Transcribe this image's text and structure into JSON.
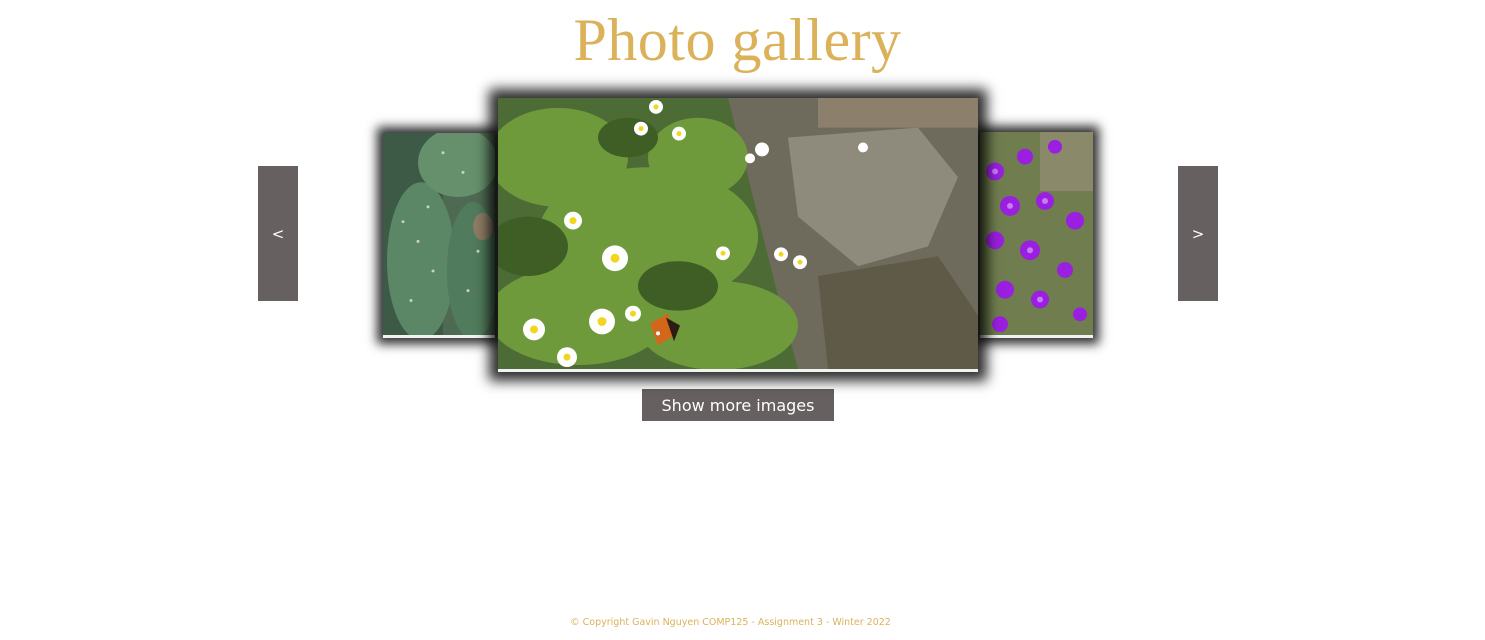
{
  "header": {
    "title": "Photo gallery"
  },
  "carousel": {
    "prev_label": "<",
    "next_label": ">",
    "slides": [
      {
        "position": "left",
        "subject": "cactus"
      },
      {
        "position": "center",
        "subject": "daisies-and-butterfly"
      },
      {
        "position": "right",
        "subject": "purple-flowers"
      }
    ]
  },
  "actions": {
    "show_more_label": "Show more images"
  },
  "footer": {
    "copyright": "© Copyright Gavin Nguyen COMP125 - Assignment 3 - Winter 2022"
  },
  "colors": {
    "title": "#dbb25a",
    "button_bg": "#666060",
    "button_text": "#ffffff",
    "footer": "#dbb25a"
  }
}
